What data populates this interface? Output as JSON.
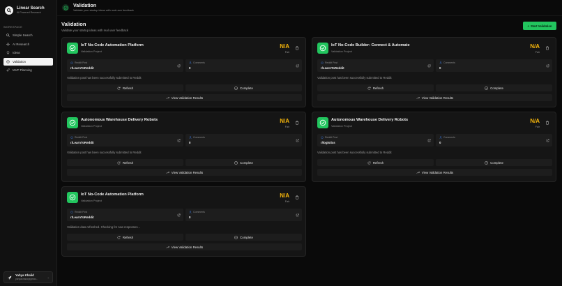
{
  "brand": {
    "title": "Linear Search",
    "subtitle": "AI Powered Research"
  },
  "sidebar": {
    "section_label": "WORKSPACE",
    "items": [
      {
        "label": "Simple Search",
        "icon": "search-icon"
      },
      {
        "label": "AI Research",
        "icon": "sparkle-icon"
      },
      {
        "label": "Ideas",
        "icon": "lightbulb-icon"
      },
      {
        "label": "Validation",
        "icon": "check-circle-icon",
        "active": true
      },
      {
        "label": "MVP Planning",
        "icon": "rocket-icon"
      }
    ]
  },
  "user": {
    "name": "Yahya Khalid",
    "email": "yahyakhalid@gmail..."
  },
  "topbar": {
    "title": "Validation",
    "subtitle": "Validate your startup ideas with real user feedback"
  },
  "page": {
    "title": "Validation",
    "subtitle": "Validate your startup ideas with real user feedback",
    "start_button": "Start Validation"
  },
  "labels": {
    "reddit_post": "Reddit Post",
    "comments": "Comments",
    "refresh": "Refresh",
    "complete": "Complete",
    "view_results": "View Validation Results"
  },
  "colors": {
    "accent": "#22c55e",
    "score": "#f5b50a",
    "background": "#0a0a0a",
    "card": "#151515"
  },
  "cards": [
    {
      "title": "IoT No-Code Automation Platform",
      "subtitle": "Validation Project",
      "score": "N/A",
      "rating": "Fair",
      "reddit": "r/LearnToReddit",
      "comments": "0",
      "message": "Validation post has been successfully submitted to Reddit"
    },
    {
      "title": "IoT No-Code Builder: Connect & Automate",
      "subtitle": "Validation Project",
      "score": "N/A",
      "rating": "Fair",
      "reddit": "r/LearnToReddit",
      "comments": "0",
      "message": "Validation post has been successfully submitted to Reddit"
    },
    {
      "title": "Autonomous Warehouse Delivery Robots",
      "subtitle": "Validation Project",
      "score": "N/A",
      "rating": "Fair",
      "reddit": "r/LearnToReddit",
      "comments": "0",
      "message": "Validation post has been successfully submitted to Reddit"
    },
    {
      "title": "Autonomous Warehouse Delivery Robots",
      "subtitle": "Validation Project",
      "score": "N/A",
      "rating": "Fair",
      "reddit": "r/logistics",
      "comments": "0",
      "message": "Validation post has been successfully submitted to Reddit"
    },
    {
      "title": "IoT No-Code Automation Platform",
      "subtitle": "Validation Project",
      "score": "N/A",
      "rating": "Fair",
      "reddit": "r/LearnToReddit",
      "comments": "0",
      "message": "Validation data refreshed. Checking for new responses..."
    }
  ]
}
